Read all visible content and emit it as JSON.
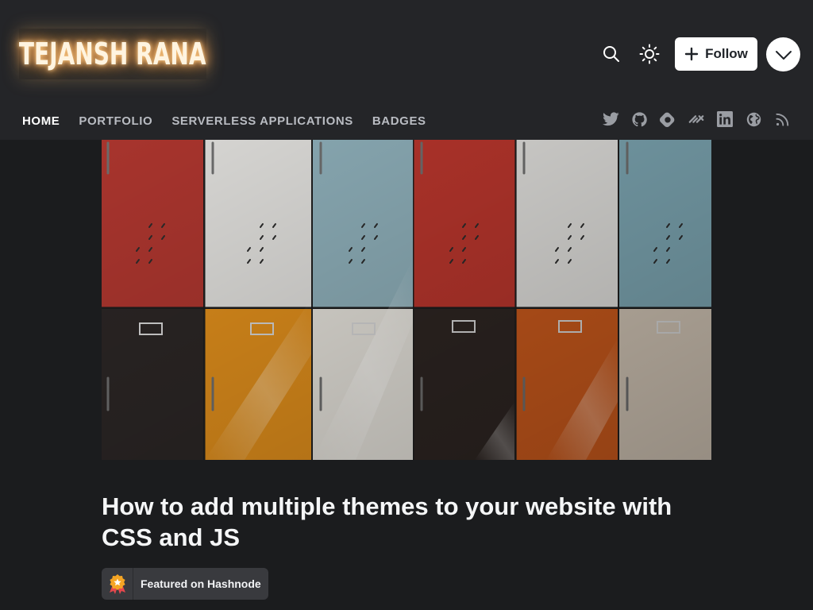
{
  "blog": {
    "name": "TEJANSH RANA"
  },
  "header": {
    "follow_label": "Follow",
    "icons": [
      "search-icon",
      "sun-icon",
      "plus-icon",
      "chevron-down-icon"
    ]
  },
  "nav": {
    "items": [
      {
        "label": "HOME",
        "active": true
      },
      {
        "label": "PORTFOLIO",
        "active": false
      },
      {
        "label": "SERVERLESS APPLICATIONS",
        "active": false
      },
      {
        "label": "BADGES",
        "active": false
      }
    ]
  },
  "socials": [
    "twitter-icon",
    "github-icon",
    "hashnode-icon",
    "dev-icon",
    "linkedin-icon",
    "website-icon",
    "rss-icon"
  ],
  "article": {
    "title": "How to add multiple themes to your website with CSS and JS",
    "featured_label": "Featured on Hashnode"
  },
  "colors": {
    "header_bg": "#242528",
    "page_bg": "#1b1c1e",
    "badge_bg": "#393a3e",
    "accent_glow": "#ffb060"
  }
}
